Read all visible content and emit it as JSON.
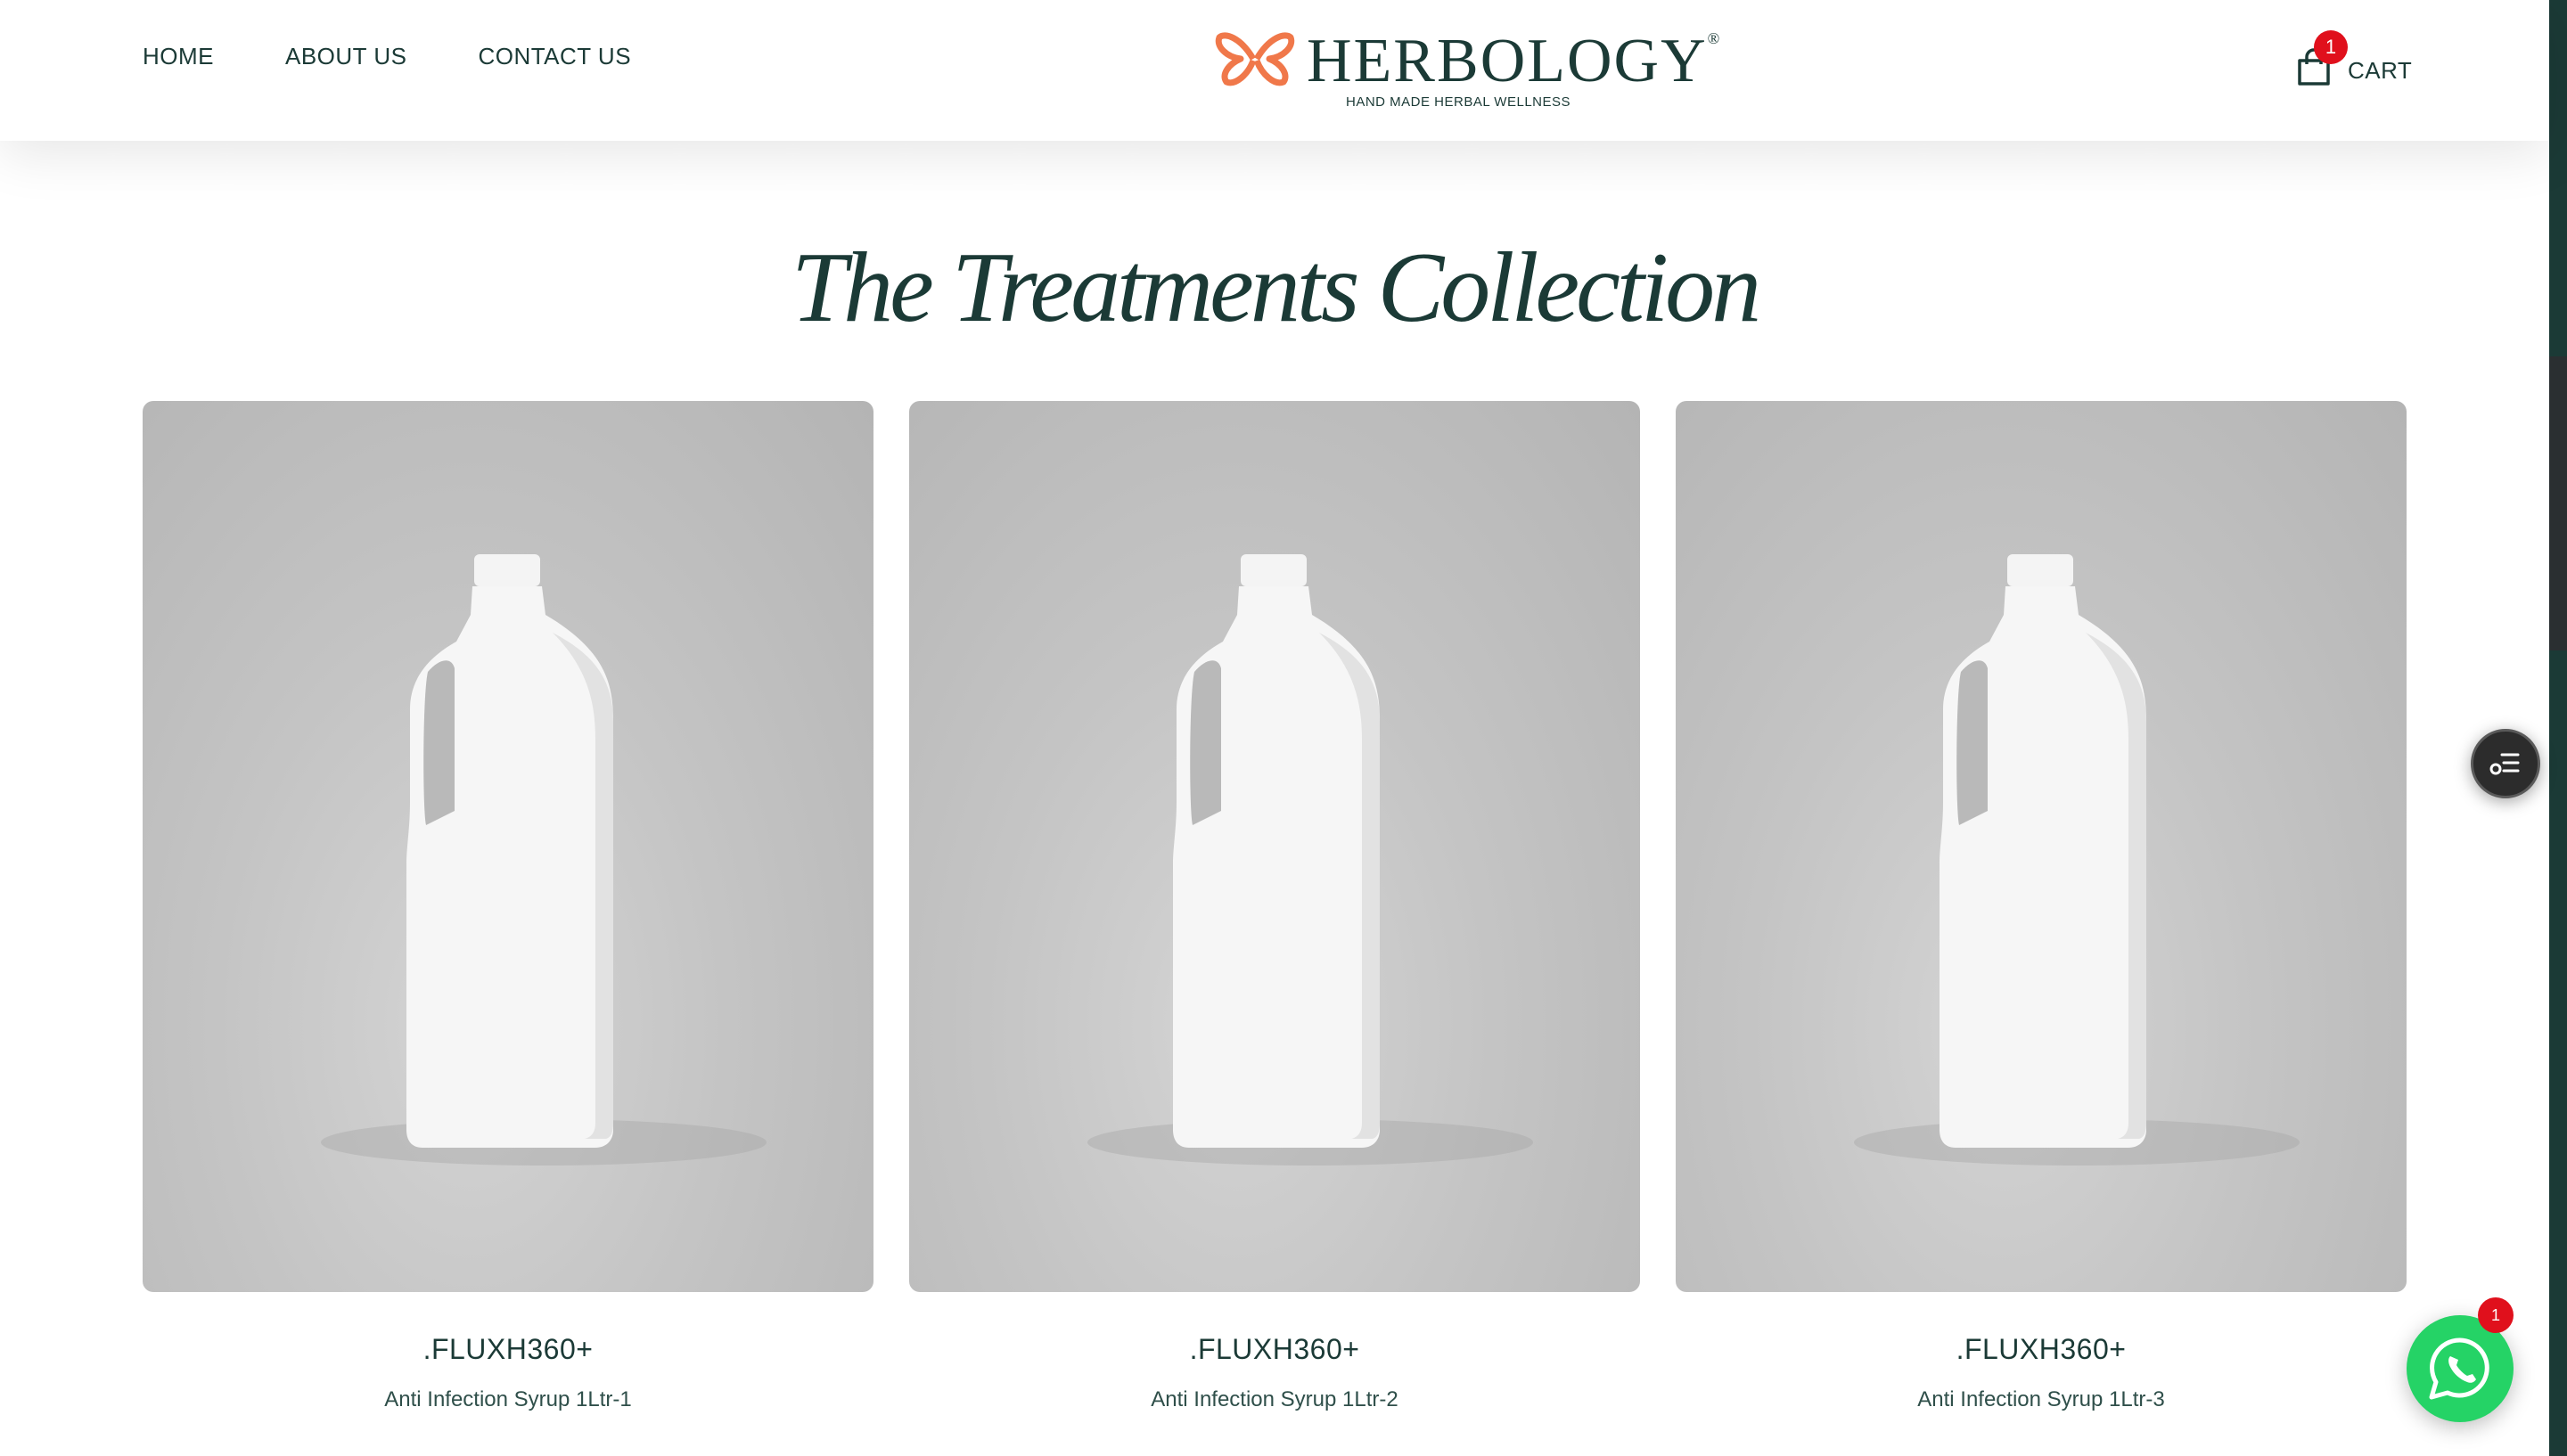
{
  "header": {
    "nav": [
      {
        "label": "HOME"
      },
      {
        "label": "ABOUT US"
      },
      {
        "label": "CONTACT US"
      }
    ],
    "logo": {
      "wordmark": "HERBOLOGY",
      "trademark": "®",
      "tagline": "HAND MADE HERBAL WELLNESS"
    },
    "cart": {
      "label": "CART",
      "count": "1"
    }
  },
  "section": {
    "title": "The Treatments Collection"
  },
  "products": [
    {
      "name": ".FLUXH360+",
      "subtitle": "Anti Infection Syrup 1Ltr-1"
    },
    {
      "name": ".FLUXH360+",
      "subtitle": "Anti Infection Syrup 1Ltr-2"
    },
    {
      "name": ".FLUXH360+",
      "subtitle": "Anti Infection Syrup 1Ltr-3"
    }
  ],
  "whatsapp": {
    "badge_count": "1"
  },
  "colors": {
    "brand": "#1b3a36",
    "accent": "#f0784a",
    "badge": "#e0101c",
    "whatsapp": "#25d366"
  },
  "icons": [
    "butterfly-logo-icon",
    "shopping-bag-icon",
    "filter-list-icon",
    "whatsapp-icon"
  ]
}
